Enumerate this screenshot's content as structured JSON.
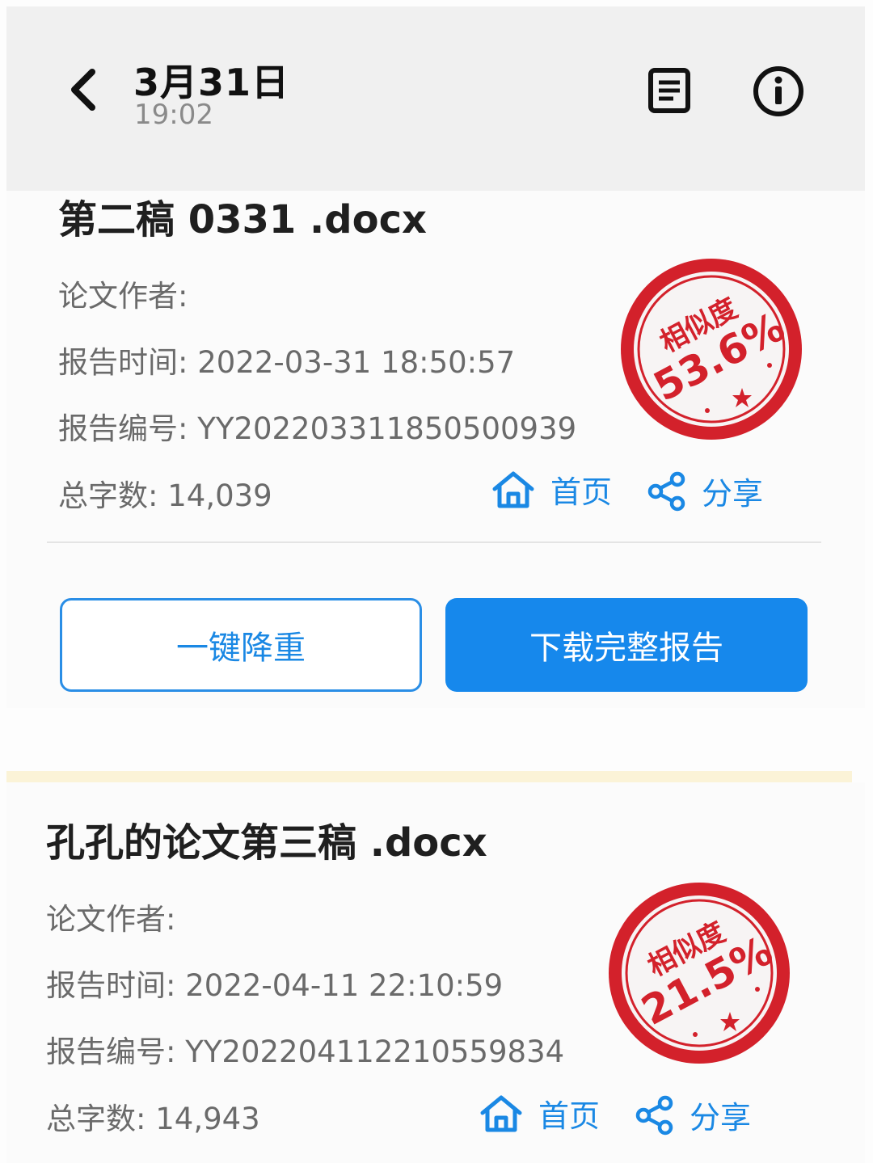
{
  "header": {
    "date": "3月31日",
    "time": "19:02"
  },
  "icons": {
    "back": "chevron-left-icon",
    "document": "document-icon",
    "info": "info-icon",
    "home": "home-icon",
    "share": "share-icon"
  },
  "colors": {
    "accent": "#1688ec",
    "stamp_red": "#d3212b",
    "header_bg": "#f0f0f0"
  },
  "reports": [
    {
      "file_name": "第二稿 0331 .docx",
      "author_label": "论文作者:",
      "time_label": "报告时间:",
      "time_value": "2022-03-31 18:50:57",
      "id_label": "报告编号:",
      "id_value": "YY202203311850500939",
      "words_label": "总字数:",
      "words_value": "14,039",
      "home_label": "首页",
      "share_label": "分享",
      "stamp_label": "相似度",
      "stamp_value": "53.6%",
      "reduce_button": "一键降重",
      "download_button": "下载完整报告"
    },
    {
      "file_name": "孔孔的论文第三稿 .docx",
      "author_label": "论文作者:",
      "time_label": "报告时间:",
      "time_value": "2022-04-11 22:10:59",
      "id_label": "报告编号:",
      "id_value": "YY202204112210559834",
      "words_label": "总字数:",
      "words_value": "14,943",
      "home_label": "首页",
      "share_label": "分享",
      "stamp_label": "相似度",
      "stamp_value": "21.5%"
    }
  ]
}
